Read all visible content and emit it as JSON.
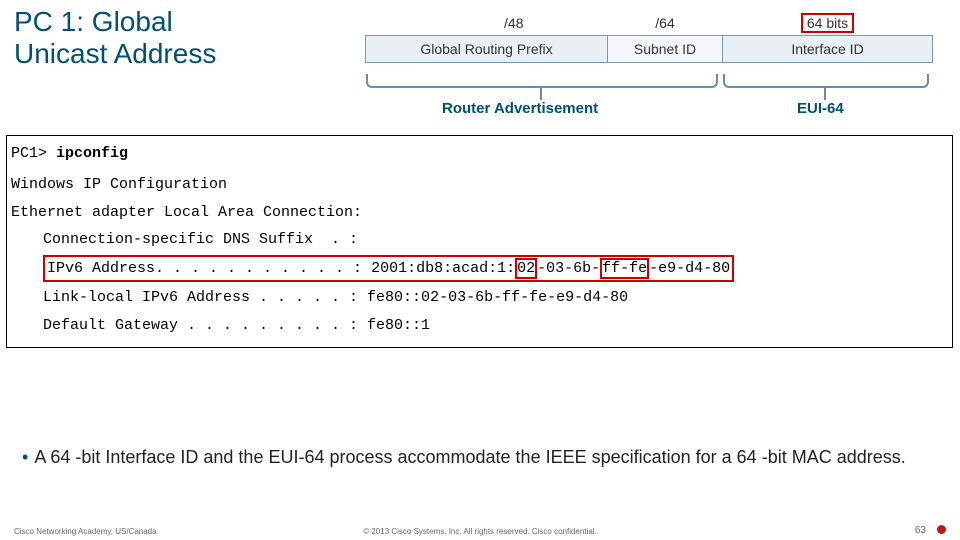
{
  "title": {
    "line1": "PC 1: Global",
    "line2": "Unicast Address"
  },
  "addr_structure": {
    "headers": {
      "prefix": "",
      "subnet": "/48",
      "iface": "/64",
      "bits": "64 bits"
    },
    "cells": {
      "prefix": "Global Routing Prefix",
      "subnet": "Subnet ID",
      "iface": "Interface ID"
    },
    "labels": {
      "ra": "Router Advertisement",
      "eui": "EUI-64"
    }
  },
  "terminal": {
    "prompt_host": "PC1> ",
    "prompt_cmd": "ipconfig",
    "heading1": "Windows IP Configuration",
    "heading2": "Ethernet adapter Local Area Connection:",
    "rows": {
      "dns": "Connection-specific DNS Suffix  . :",
      "ipv6_label": "IPv6 Address. . . . . . . . . . . : ",
      "ipv6_addr_pre": "2001:db8:acad:1:",
      "ipv6_addr_seg1": "02",
      "ipv6_addr_mid": "-03-6b-",
      "ipv6_addr_seg2": "ff-fe",
      "ipv6_addr_post": "-e9-d4-80",
      "ll": "Link-local IPv6 Address . . . . . : fe80::02-03-6b-ff-fe-e9-d4-80",
      "gw": "Default Gateway . . . . . . . . . : fe80::1"
    }
  },
  "bullet_text": "A 64 -bit Interface ID and the EUI-64 process accommodate the IEEE specification for a 64 -bit MAC address.",
  "footer": {
    "left": "Cisco Networking Academy, US/Canada",
    "center": "© 2013 Cisco Systems, Inc. All rights reserved. Cisco confidential.",
    "page": "63"
  }
}
